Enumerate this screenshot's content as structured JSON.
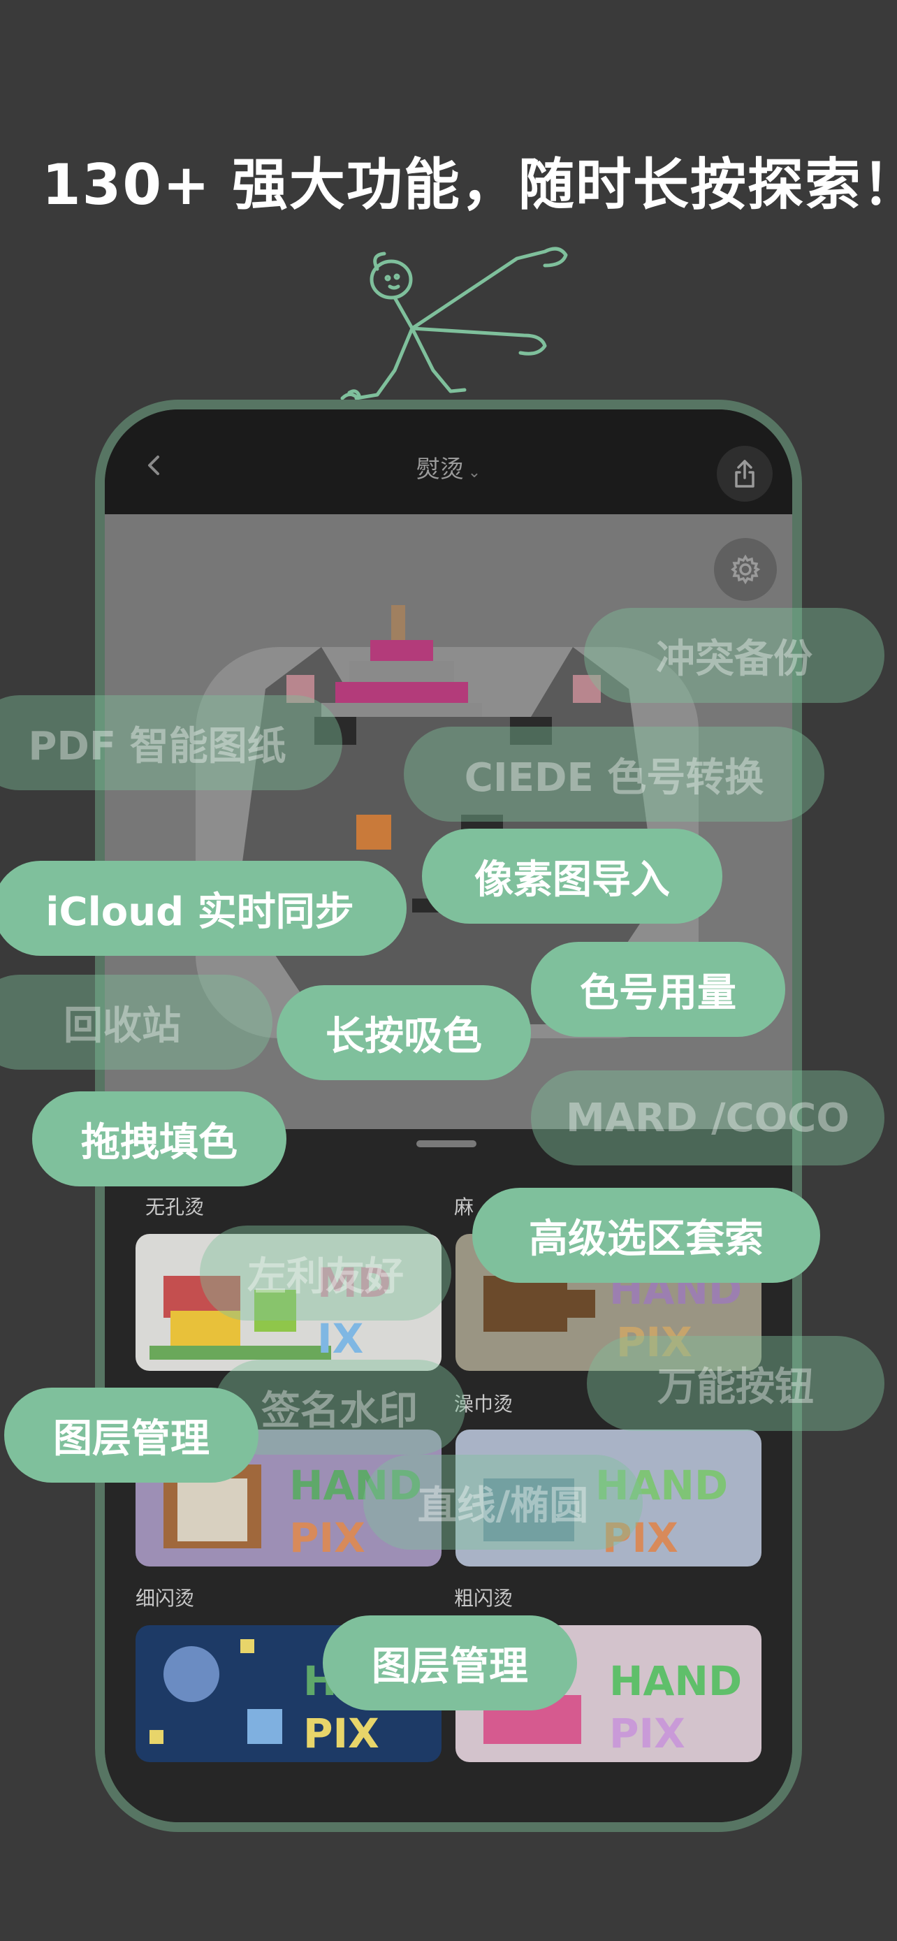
{
  "headline": "130+ 强大功能，随时长按探索！",
  "phone": {
    "title": "熨烫",
    "back_icon": "chevron-left-icon",
    "share_icon": "share-icon",
    "settings_icon": "gear-icon",
    "sections": [
      {
        "label": "无孔烫"
      },
      {
        "label": "麻"
      },
      {
        "label": "澡巾烫"
      },
      {
        "label": "细闪烫"
      },
      {
        "label": "粗闪烫"
      }
    ]
  },
  "pills": {
    "conflict_backup": "冲突备份",
    "pdf_pattern": "PDF 智能图纸",
    "ciede": "CIEDE 色号转换",
    "pixel_import": "像素图导入",
    "icloud_sync": "iCloud 实时同步",
    "color_usage": "色号用量",
    "recycle_bin": "回收站",
    "long_press_pick": "长按吸色",
    "drag_fill": "拖拽填色",
    "mard_coco": "MARD /COCO",
    "lasso": "高级选区套索",
    "left_hand": "左利友好",
    "universal_button": "万能按钮",
    "signature": "签名水印",
    "layers_1": "图层管理",
    "line_ellipse": "直线/椭圆",
    "layers_2": "图层管理"
  },
  "colors": {
    "accent": "#7fc09c",
    "phone_frame": "#577563",
    "background": "#3a3a3a"
  }
}
